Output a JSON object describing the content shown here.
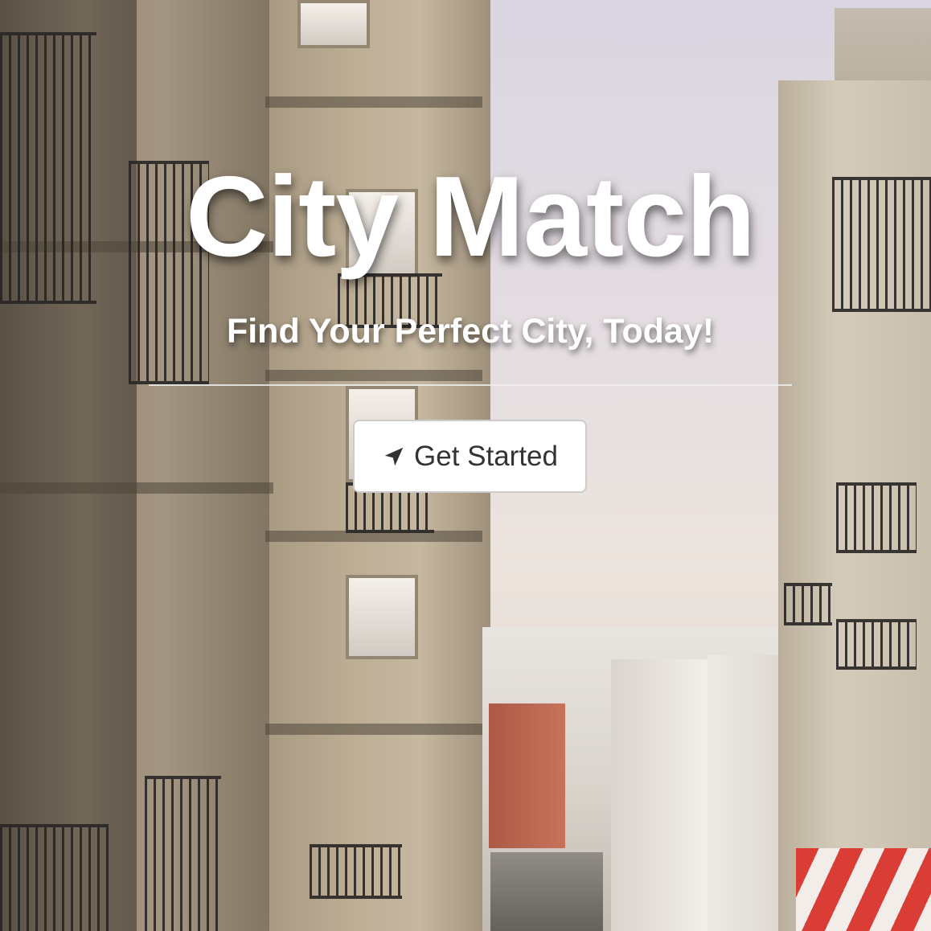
{
  "hero": {
    "title": "City Match",
    "subtitle": "Find Your Perfect City, Today!",
    "cta_label": "Get Started",
    "cta_icon": "navigation-arrow-icon"
  },
  "colors": {
    "title_text": "#ffffff",
    "button_background": "#ffffff",
    "button_text": "#333333",
    "button_border": "#cccccc",
    "awning_red": "#d8322c"
  }
}
